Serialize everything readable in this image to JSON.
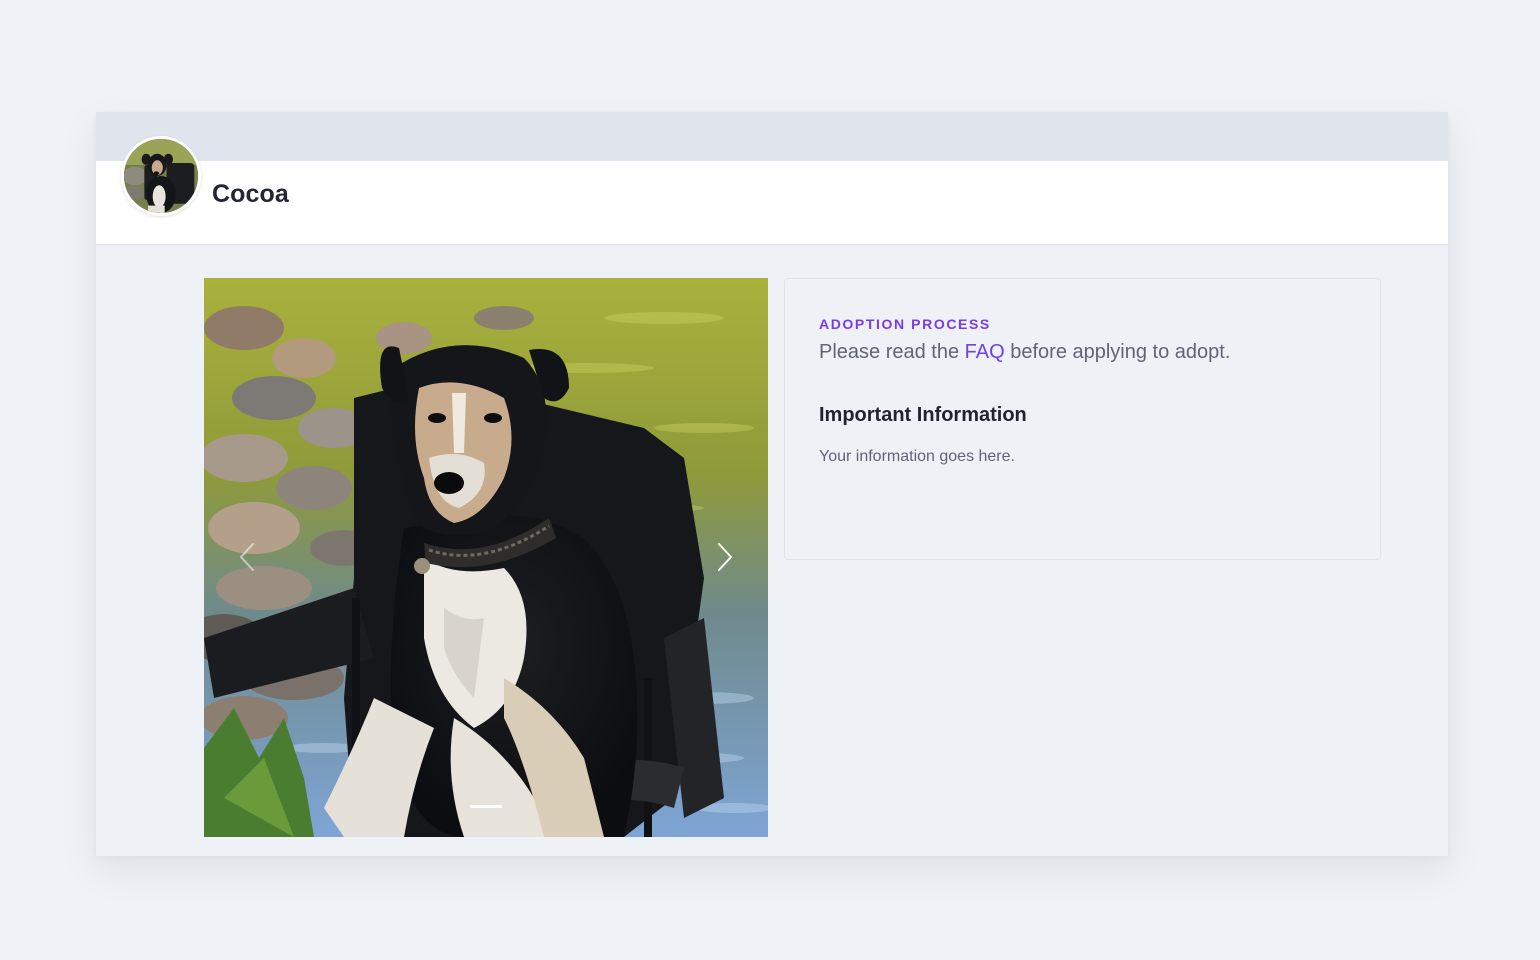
{
  "profile": {
    "name": "Cocoa",
    "avatar_alt": "dog-avatar"
  },
  "carousel": {
    "prev_icon": "chevron-left-icon",
    "next_icon": "chevron-right-icon",
    "slide_count_visible": 1,
    "active_slide": 1
  },
  "info": {
    "eyebrow": "ADOPTION PROCESS",
    "lead_prefix": "Please read the ",
    "lead_link": "FAQ",
    "lead_suffix": " before applying to adopt.",
    "section_title": "Important Information",
    "section_body": "Your information goes here."
  },
  "colors": {
    "accent": "#7c3aed",
    "link": "#6d3ff0",
    "page_bg": "#eff2f6",
    "banner_bg": "#e0e5ed"
  }
}
